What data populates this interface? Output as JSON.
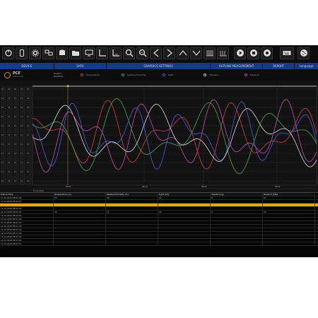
{
  "toolbar": {
    "icons": [
      "power-icon",
      "device-icon",
      "settings-icon",
      "monitor-sync-icon",
      "database-icon",
      "folder-icon",
      "screen-icon",
      "axis-icon",
      "axis-zoom-icon",
      "zoom-in-icon",
      "zoom-out-icon",
      "prev-icon",
      "next-icon",
      "up-icon",
      "down-icon",
      "bars-icon",
      "range-icon",
      "play-icon",
      "stop-icon",
      "record-icon",
      "keyboard-icon",
      "globe-icon"
    ]
  },
  "sections": [
    {
      "label": "DEVICE"
    },
    {
      "label": "DATA"
    },
    {
      "label": "GRAPHICS SETTINGS"
    },
    {
      "label": "OUTLINE MEASUREMENT"
    },
    {
      "label": "REPORT"
    },
    {
      "label": "Language"
    }
  ],
  "brand": {
    "name": "PCE",
    "sub": "Instruments"
  },
  "mode": {
    "line1": "Graphic",
    "line2": "Realtime"
  },
  "legend": [
    {
      "label": "Temperature",
      "color": "#c23b3b"
    },
    {
      "label": "Relative Humidity",
      "color": "#3c9a4b"
    },
    {
      "label": "Light",
      "color": "#4058c9"
    },
    {
      "label": "Vibration",
      "color": "#c8c8c8"
    },
    {
      "label": "Pressure",
      "color": "#b0489c"
    }
  ],
  "chart_data": {
    "type": "line",
    "y_ticks": [
      20,
      19,
      18,
      17,
      16,
      15,
      14,
      13,
      12,
      11,
      10
    ],
    "x_ticks": [
      "08:00",
      "08:10",
      "08:20",
      "08:30"
    ],
    "date_label": "12.12.2016",
    "series": [
      {
        "name": "Temperature",
        "color": "#c23b3b"
      },
      {
        "name": "Relative Humidity",
        "color": "#3c9a4b"
      },
      {
        "name": "Light",
        "color": "#4058c9"
      },
      {
        "name": "Vibration",
        "color": "#c8c8c8"
      },
      {
        "name": "Pressure",
        "color": "#b0489c"
      }
    ]
  },
  "table": {
    "headers": [
      "Date & Time",
      "Temperature [°C]",
      "Relative Humidity [%]",
      "Light [lux]",
      "Vibration [g]",
      "Pressure [hPa]"
    ],
    "rows": [
      [
        "12.12.2016 08:00:00",
        "20",
        "26",
        "22",
        "6",
        "25"
      ],
      [
        "12.12.2016 08:00:10",
        "",
        "",
        "",
        "",
        ""
      ],
      [
        "12.12.2016 08:00:20",
        "",
        "",
        "",
        "",
        ""
      ],
      [
        "12.12.2016 08:00:30",
        "",
        "",
        "",
        "",
        ""
      ],
      [
        "12.12.2016 08:00:40",
        "20",
        "11",
        "22",
        "4",
        "22"
      ],
      [
        "12.12.2016 08:00:50",
        "",
        "",
        "",
        "",
        ""
      ],
      [
        "12.12.2016 08:01:00",
        "",
        "",
        "",
        "",
        ""
      ],
      [
        "12.12.2016 08:01:10",
        "",
        "",
        "",
        "",
        ""
      ],
      [
        "12.12.2016 08:01:20",
        "",
        "",
        "",
        "",
        ""
      ],
      [
        "12.12.2016 08:01:30",
        "",
        "",
        "",
        "",
        ""
      ],
      [
        "12.12.2016 08:01:40",
        "",
        "",
        "",
        "",
        ""
      ],
      [
        "12.12.2016 08:01:50",
        "",
        "",
        "",
        "",
        ""
      ],
      [
        "12.12.2016 08:02:00",
        "",
        "",
        "",
        "",
        ""
      ],
      [
        "12.12.2016 08:02:10",
        "",
        "",
        "",
        "",
        ""
      ]
    ]
  }
}
